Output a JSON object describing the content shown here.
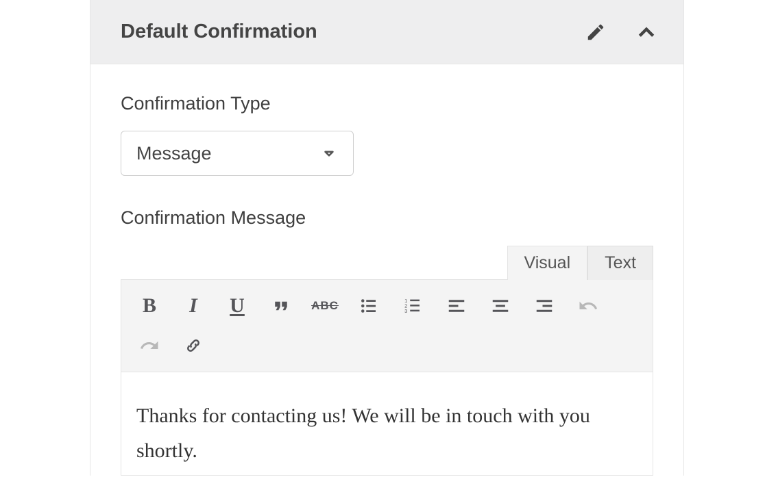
{
  "header": {
    "title": "Default Confirmation"
  },
  "fields": {
    "type_label": "Confirmation Type",
    "type_value": "Message",
    "message_label": "Confirmation Message"
  },
  "editor": {
    "tabs": {
      "visual": "Visual",
      "text": "Text",
      "active": "visual"
    },
    "toolbar": {
      "strikethrough_label": "ABC"
    },
    "content": "Thanks for contacting us! We will be in touch with you shortly."
  }
}
